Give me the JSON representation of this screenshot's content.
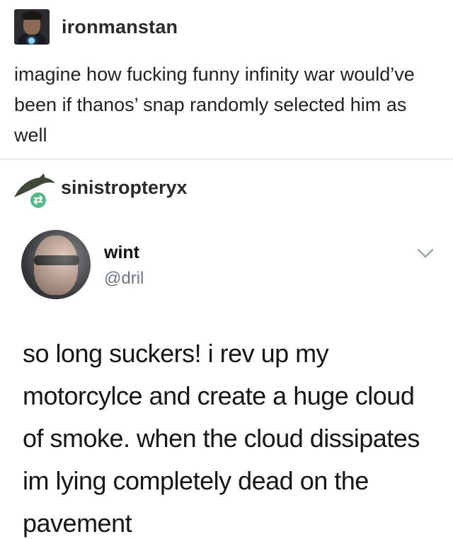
{
  "post": {
    "author": "ironmanstan",
    "text": "imagine how fucking funny infinity war would’ve been if thanos’ snap randomly selected him as well"
  },
  "reblog": {
    "author": "sinistropteryx"
  },
  "tweet": {
    "name": "wint",
    "handle": "@dril",
    "text": "so long suckers! i rev up my motorcylce and create a huge cloud of smoke. when the cloud dissipates im lying completely dead on the pavement"
  },
  "icons": {
    "reblog": "reblog-icon",
    "menu": "chevron-down-icon"
  },
  "colors": {
    "reblog_badge": "#56b88a",
    "handle": "#6b7780"
  }
}
